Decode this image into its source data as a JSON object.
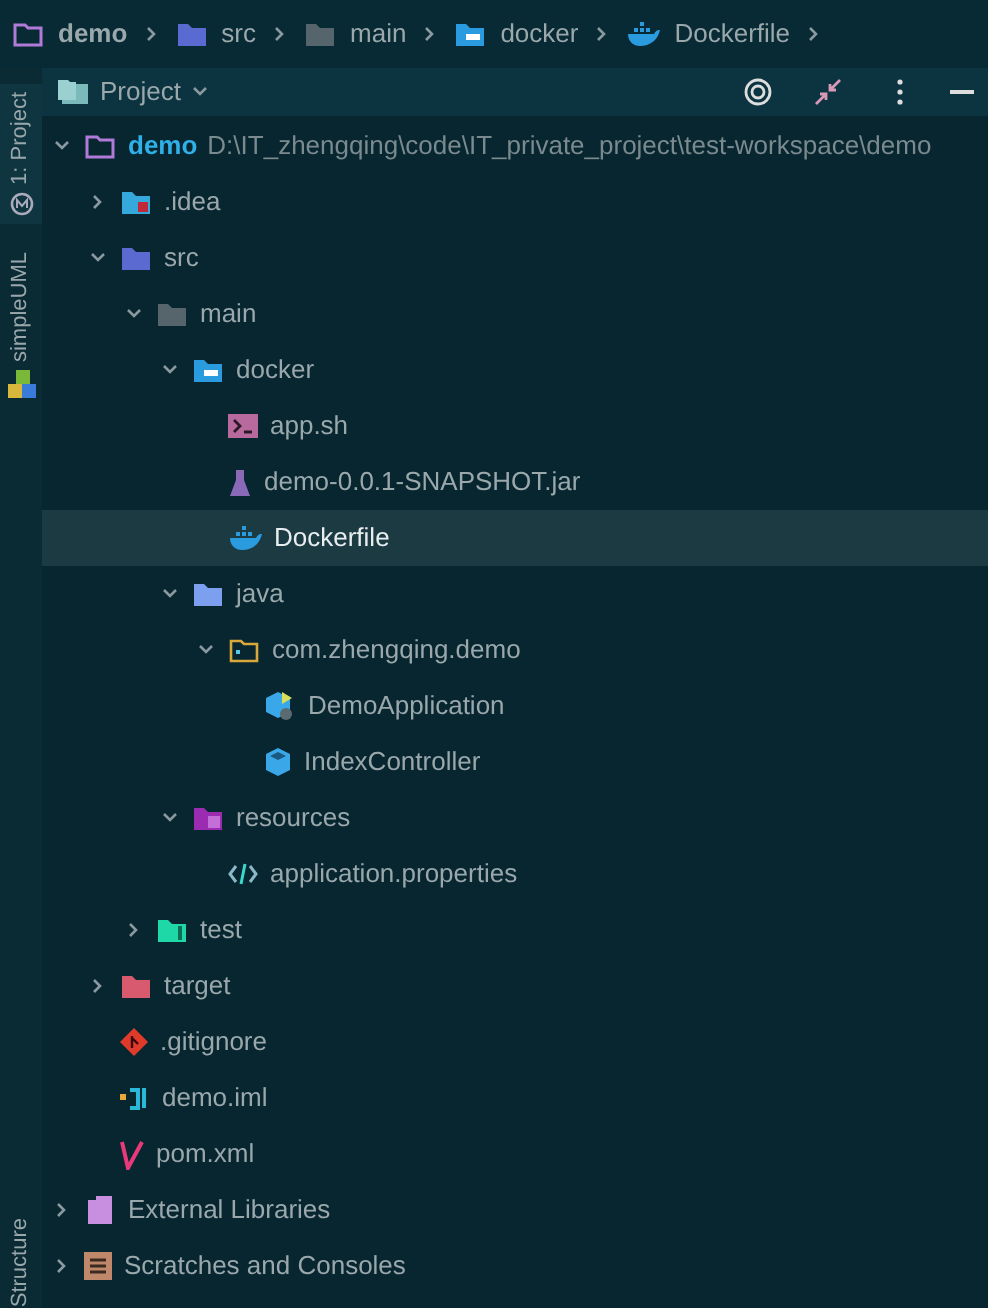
{
  "breadcrumbs": [
    {
      "label": "demo",
      "kind": "module"
    },
    {
      "label": "src",
      "kind": "src"
    },
    {
      "label": "main",
      "kind": "folder"
    },
    {
      "label": "docker",
      "kind": "docker-folder"
    },
    {
      "label": "Dockerfile",
      "kind": "docker"
    }
  ],
  "side_tabs": [
    {
      "label": "1: Project",
      "kind": "project",
      "selected": true
    },
    {
      "label": "simpleUML",
      "kind": "uml",
      "selected": false
    }
  ],
  "side_tab_bottom": "Structure",
  "panel": {
    "title": "Project"
  },
  "tree": [
    {
      "name": "demo",
      "path": "D:\\IT_zhengqing\\code\\IT_private_project\\test-workspace\\demo",
      "kind": "module",
      "expanded": true,
      "selected": false,
      "children": [
        {
          "name": ".idea",
          "kind": "idea",
          "expanded": false,
          "selected": false
        },
        {
          "name": "src",
          "kind": "src",
          "expanded": true,
          "selected": false,
          "children": [
            {
              "name": "main",
              "kind": "folder",
              "expanded": true,
              "selected": false,
              "children": [
                {
                  "name": "docker",
                  "kind": "docker-folder",
                  "expanded": true,
                  "selected": false,
                  "children": [
                    {
                      "name": "app.sh",
                      "kind": "shell",
                      "selected": false
                    },
                    {
                      "name": "demo-0.0.1-SNAPSHOT.jar",
                      "kind": "jar",
                      "selected": false
                    },
                    {
                      "name": "Dockerfile",
                      "kind": "docker",
                      "selected": true
                    }
                  ]
                },
                {
                  "name": "java",
                  "kind": "java-folder",
                  "expanded": true,
                  "selected": false,
                  "children": [
                    {
                      "name": "com.zhengqing.demo",
                      "kind": "package",
                      "expanded": true,
                      "selected": false,
                      "children": [
                        {
                          "name": "DemoApplication",
                          "kind": "app-class",
                          "selected": false
                        },
                        {
                          "name": "IndexController",
                          "kind": "class",
                          "selected": false
                        }
                      ]
                    }
                  ]
                },
                {
                  "name": "resources",
                  "kind": "resources",
                  "expanded": true,
                  "selected": false,
                  "children": [
                    {
                      "name": "application.properties",
                      "kind": "properties",
                      "selected": false
                    }
                  ]
                }
              ]
            },
            {
              "name": "test",
              "kind": "test",
              "expanded": false,
              "selected": false
            }
          ]
        },
        {
          "name": "target",
          "kind": "target",
          "expanded": false,
          "selected": false
        },
        {
          "name": ".gitignore",
          "kind": "git",
          "selected": false
        },
        {
          "name": "demo.iml",
          "kind": "iml",
          "selected": false
        },
        {
          "name": "pom.xml",
          "kind": "maven",
          "selected": false
        }
      ]
    },
    {
      "name": "External Libraries",
      "kind": "libraries",
      "expanded": false,
      "selected": false
    },
    {
      "name": "Scratches and Consoles",
      "kind": "scratches",
      "expanded": false,
      "selected": false
    }
  ]
}
